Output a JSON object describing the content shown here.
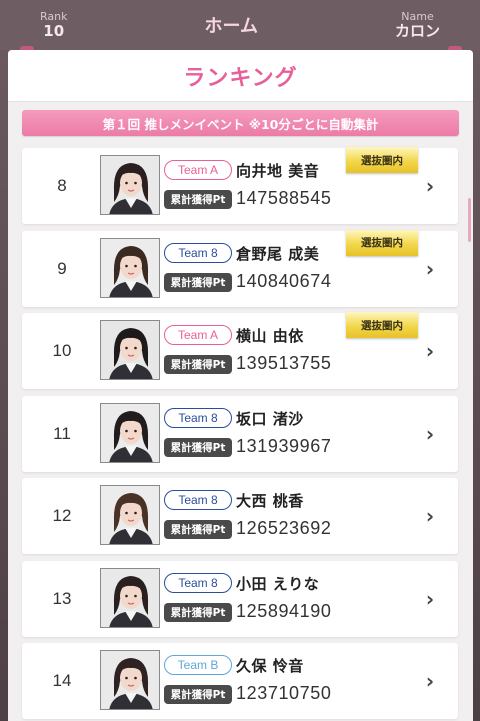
{
  "header": {
    "left": {
      "label": "Rank",
      "value": "10"
    },
    "title": "ホーム",
    "right": {
      "label": "Name",
      "value": "カロン"
    }
  },
  "modal": {
    "title": "ランキング",
    "event_banner": "第１回 推しメンイベント ※10分ごとに自動集計"
  },
  "colors": {
    "pink_accent": "#e8609a",
    "team_a": "#e8609a",
    "team_8": "#2a4f9a",
    "team_b": "#5fa8d8",
    "badge_gold": "#f2d74a"
  },
  "rows": [
    {
      "rank": "8",
      "team": "Team A",
      "team_key": "team_a",
      "name": "向井地 美音",
      "pt_label": "累計獲得Pt",
      "points": "147588545",
      "badge": "選抜圏内",
      "hair": "#2b2020",
      "bg": "#e9e9ea"
    },
    {
      "rank": "9",
      "team": "Team 8",
      "team_key": "team_8",
      "name": "倉野尾 成美",
      "pt_label": "累計獲得Pt",
      "points": "140840674",
      "badge": "選抜圏内",
      "hair": "#3a2a22",
      "bg": "#ececec"
    },
    {
      "rank": "10",
      "team": "Team A",
      "team_key": "team_a",
      "name": "横山 由依",
      "pt_label": "累計獲得Pt",
      "points": "139513755",
      "badge": "選抜圏内",
      "hair": "#1e1a1a",
      "bg": "#e7e7e8"
    },
    {
      "rank": "11",
      "team": "Team 8",
      "team_key": "team_8",
      "name": "坂口 渚沙",
      "pt_label": "累計獲得Pt",
      "points": "131939967",
      "badge": "",
      "hair": "#231c1c",
      "bg": "#ebebeb"
    },
    {
      "rank": "12",
      "team": "Team 8",
      "team_key": "team_8",
      "name": "大西 桃香",
      "pt_label": "累計獲得Pt",
      "points": "126523692",
      "badge": "",
      "hair": "#4a3326",
      "bg": "#ececec"
    },
    {
      "rank": "13",
      "team": "Team 8",
      "team_key": "team_8",
      "name": "小田 えりな",
      "pt_label": "累計獲得Pt",
      "points": "125894190",
      "badge": "",
      "hair": "#2a2020",
      "bg": "#e9e9e9"
    },
    {
      "rank": "14",
      "team": "Team B",
      "team_key": "team_b",
      "name": "久保 怜音",
      "pt_label": "累計獲得Pt",
      "points": "123710750",
      "badge": "",
      "hair": "#2e2222",
      "bg": "#eaeaea"
    }
  ]
}
